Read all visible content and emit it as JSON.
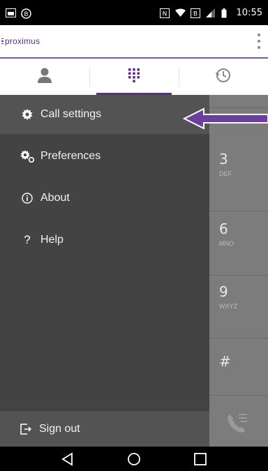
{
  "status_bar": {
    "time": "10:55",
    "icons": [
      "image-icon",
      "notification-icon",
      "nfc-icon",
      "wifi-icon",
      "data-icon",
      "signal-icon",
      "battery-icon"
    ]
  },
  "header": {
    "logo_text": "proximus",
    "menu_icon": "overflow-menu-icon",
    "accent_color": "#5b2d91"
  },
  "tabs": [
    {
      "name": "contacts",
      "icon": "person-icon",
      "active": false
    },
    {
      "name": "dialpad",
      "icon": "dialpad-icon",
      "active": true
    },
    {
      "name": "history",
      "icon": "history-icon",
      "active": false
    }
  ],
  "drawer": {
    "items": [
      {
        "label": "Call settings",
        "icon": "gear-icon",
        "selected": true
      },
      {
        "label": "Preferences",
        "icon": "preferences-gears-icon",
        "selected": false
      },
      {
        "label": "About",
        "icon": "info-icon",
        "selected": false
      },
      {
        "label": "Help",
        "icon": "question-icon",
        "selected": false
      }
    ],
    "sign_out": {
      "label": "Sign out",
      "icon": "sign-out-icon"
    }
  },
  "dialpad": {
    "keys": [
      {
        "digit": "3",
        "letters": "DEF"
      },
      {
        "digit": "6",
        "letters": "MNO"
      },
      {
        "digit": "9",
        "letters": "WXYZ"
      },
      {
        "digit": "#",
        "letters": ""
      }
    ]
  },
  "annotation": {
    "color": "#6a3fa0"
  },
  "nav_bar": {
    "icons": [
      "back-icon",
      "home-icon",
      "recents-icon"
    ]
  }
}
